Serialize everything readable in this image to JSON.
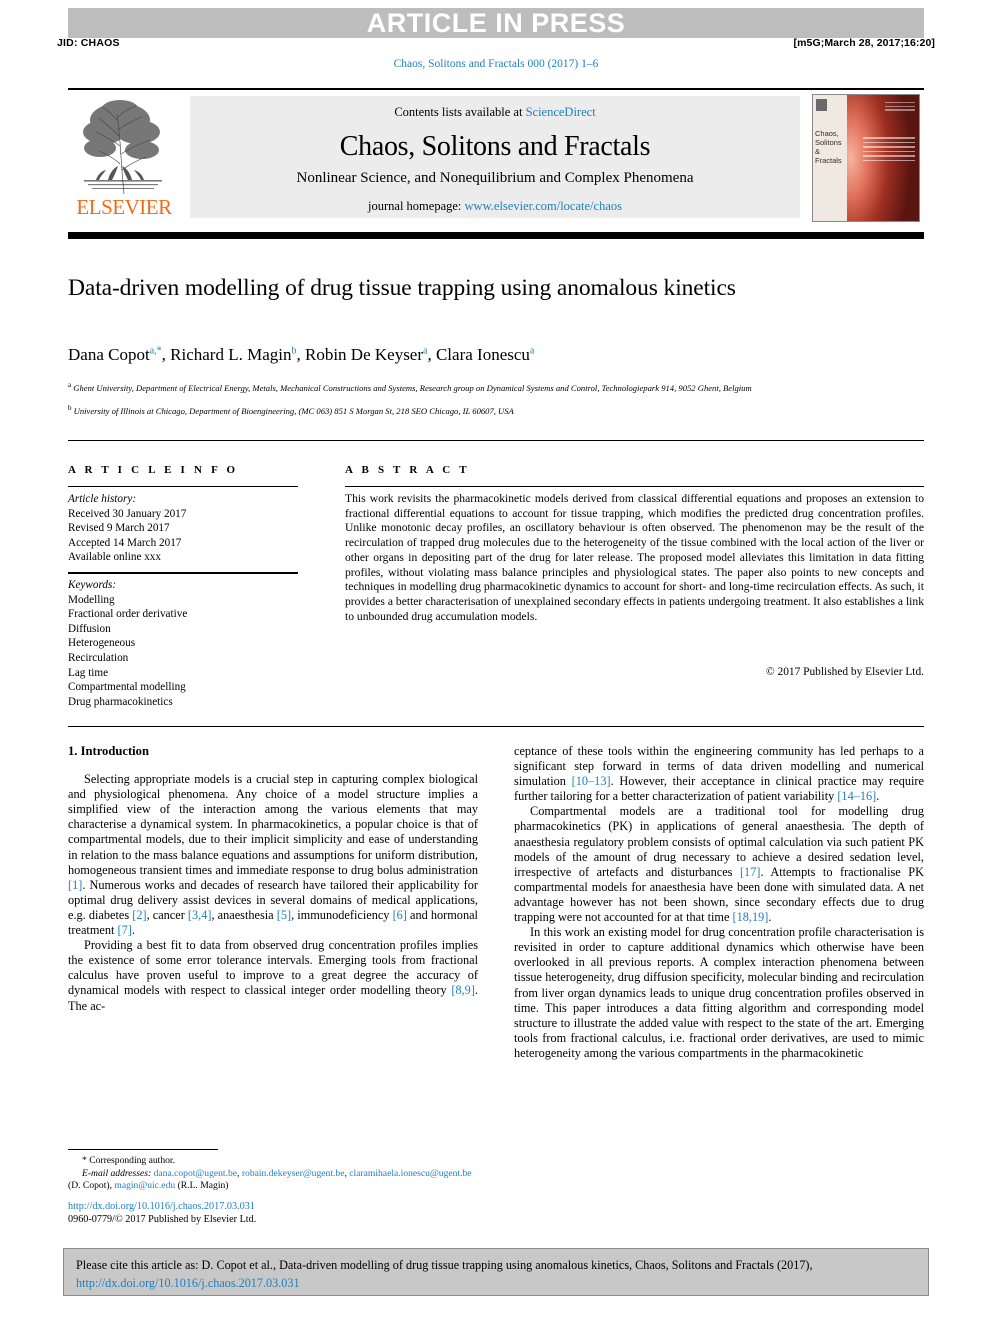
{
  "banner": {
    "article_in_press": "ARTICLE IN PRESS",
    "jid": "JID: CHAOS",
    "production_stamp": "[m5G;March 28, 2017;16:20]",
    "running_head": "Chaos, Solitons and Fractals 000 (2017) 1–6"
  },
  "masthead": {
    "contents_prefix": "Contents lists available at ",
    "sciencedirect": "ScienceDirect",
    "journal_title": "Chaos, Solitons and Fractals",
    "journal_subtitle": "Nonlinear Science, and Nonequilibrium and Complex Phenomena",
    "homepage_prefix": "journal homepage: ",
    "homepage_url": "www.elsevier.com/locate/chaos",
    "publisher_logo": "ELSEVIER",
    "cover_title": "Chaos, Solitons & Fractals"
  },
  "article": {
    "title": "Data-driven modelling of drug tissue trapping using anomalous kinetics",
    "authors_html": "Dana Copot<sup>a,*</sup>, Richard L. Magin<sup>b</sup>, Robin De Keyser<sup>a</sup>, Clara Ionescu<sup>a</sup>",
    "affiliation_a": "Ghent University, Department of Electrical Energy, Metals, Mechanical Constructions and Systems, Research group on Dynamical Systems and Control, Technologiepark 914, 9052 Ghent, Belgium",
    "affiliation_b": "University of Illinois at Chicago, Department of Bioengineering, (MC 063) 851 S Morgan St, 218 SEO Chicago, IL 60607, USA"
  },
  "info": {
    "heading": "A R T I C L E   I N F O",
    "history_label": "Article history:",
    "history": [
      "Received 30 January 2017",
      "Revised 9 March 2017",
      "Accepted 14 March 2017",
      "Available online xxx"
    ],
    "keywords_label": "Keywords:",
    "keywords": [
      "Modelling",
      "Fractional order derivative",
      "Diffusion",
      "Heterogeneous",
      "Recirculation",
      "Lag time",
      "Compartmental modelling",
      "Drug pharmacokinetics"
    ]
  },
  "abstract": {
    "heading": "A B S T R A C T",
    "text": "This work revisits the pharmacokinetic models derived from classical differential equations and proposes an extension to fractional differential equations to account for tissue trapping, which modifies the predicted drug concentration profiles. Unlike monotonic decay profiles, an oscillatory behaviour is often observed. The phenomenon may be the result of the recirculation of trapped drug molecules due to the heterogeneity of the tissue combined with the local action of the liver or other organs in depositing part of the drug for later release. The proposed model alleviates this limitation in data fitting profiles, without violating mass balance principles and physiological states. The paper also points to new concepts and techniques in modelling drug pharmacokinetic dynamics to account for short- and long-time recirculation effects. As such, it provides a better characterisation of unexplained secondary effects in patients undergoing treatment. It also establishes a link to unbounded drug accumulation models.",
    "copyright": "© 2017 Published by Elsevier Ltd."
  },
  "body": {
    "section_heading": "1. Introduction",
    "left_paragraphs": [
      "Selecting appropriate models is a crucial step in capturing complex biological and physiological phenomena. Any choice of a model structure implies a simplified view of the interaction among the various elements that may characterise a dynamical system. In pharmacokinetics, a popular choice is that of compartmental models, due to their implicit simplicity and ease of understanding in relation to the mass balance equations and assumptions for uniform distribution, homogeneous transient times and immediate response to drug bolus administration [1]. Numerous works and decades of research have tailored their applicability for optimal drug delivery assist devices in several domains of medical applications, e.g. diabetes [2], cancer [3,4], anaesthesia [5], immunodeficiency [6] and hormonal treatment [7].",
      "Providing a best fit to data from observed drug concentration profiles implies the existence of some error tolerance intervals. Emerging tools from fractional calculus have proven useful to improve to a great degree the accuracy of dynamical models with respect to classical integer order modelling theory [8,9]. The ac-"
    ],
    "right_paragraphs": [
      "ceptance of these tools within the engineering community has led perhaps to a significant step forward in terms of data driven modelling and numerical simulation [10–13]. However, their acceptance in clinical practice may require further tailoring for a better characterization of patient variability [14–16].",
      "Compartmental models are a traditional tool for modelling drug pharmacokinetics (PK) in applications of general anaesthesia. The depth of anaesthesia regulatory problem consists of optimal calculation via such patient PK models of the amount of drug necessary to achieve a desired sedation level, irrespective of artefacts and disturbances [17]. Attempts to fractionalise PK compartmental models for anaesthesia have been done with simulated data. A net advantage however has not been shown, since secondary effects due to drug trapping were not accounted for at that time [18,19].",
      "In this work an existing model for drug concentration profile characterisation is revisited in order to capture additional dynamics which otherwise have been overlooked in all previous reports. A complex interaction phenomena between tissue heterogeneity, drug diffusion specificity, molecular binding and recirculation from liver organ dynamics leads to unique drug concentration profiles observed in time. This paper introduces a data fitting algorithm and corresponding model structure to illustrate the added value with respect to the state of the art. Emerging tools from fractional calculus, i.e. fractional order derivatives, are used to mimic heterogeneity among the various compartments in the pharmacokinetic"
    ]
  },
  "footnote": {
    "corresponding_label": "* Corresponding author.",
    "email_label": "E-mail addresses:",
    "emails": [
      "dana.copot@ugent.be",
      "robain.dekeyser@ugent.be",
      "claramihaela.ionescu@ugent.be",
      "magin@uic.edu"
    ],
    "email_line1_tail": ",",
    "attrib1": "(D. Copot),",
    "attrib2": "(R.L. Magin)",
    "doi_url": "http://dx.doi.org/10.1016/j.chaos.2017.03.031",
    "issn_line": "0960-0779/© 2017 Published by Elsevier Ltd."
  },
  "citation_footer": {
    "prefix": "Please cite this article as: D. Copot et al., Data-driven modelling of drug tissue trapping using anomalous kinetics, Chaos, Solitons and Fractals (2017), ",
    "url": "http://dx.doi.org/10.1016/j.chaos.2017.03.031"
  },
  "colors": {
    "link": "#1f7fbf",
    "banner_gray": "#bdbdbd",
    "masthead_gray": "#ececec",
    "footer_gray": "#c8c8c8",
    "elsevier_orange": "#ef6c1a"
  }
}
